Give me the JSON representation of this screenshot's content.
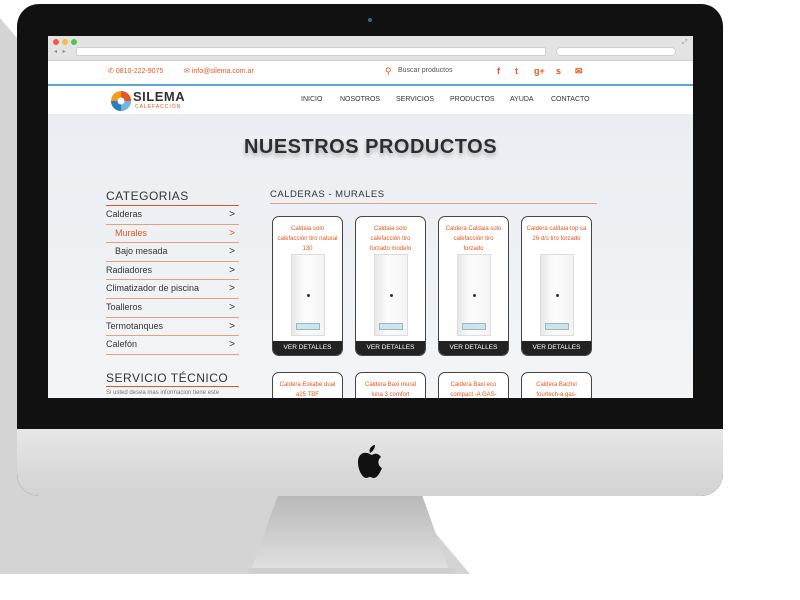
{
  "browser": {
    "address": "",
    "search_placeholder": ""
  },
  "topbar": {
    "phone": "0810-222-9075",
    "email": "info@silema.com.ar",
    "search_label": "Buscar productos",
    "social_icons": [
      "facebook-icon",
      "twitter-icon",
      "google-plus-icon",
      "skype-icon",
      "mail-icon"
    ]
  },
  "brand": {
    "name": "SILEMA",
    "tagline": "CALEFACCIÓN"
  },
  "nav": {
    "items": [
      "INICIO",
      "NOSOTROS",
      "SERVICIOS",
      "PRODUCTOS",
      "AYUDA",
      "CONTACTO"
    ]
  },
  "page": {
    "title": "NUESTROS PRODUCTOS"
  },
  "sidebar": {
    "heading": "CATEGORIAS",
    "items": [
      {
        "label": "Calderas"
      },
      {
        "label": "Murales"
      },
      {
        "label": "Bajo mesada"
      },
      {
        "label": "Radiadores"
      },
      {
        "label": "Climatizador de piscina"
      },
      {
        "label": "Toalleros"
      },
      {
        "label": "Termotanques"
      },
      {
        "label": "Calefón"
      }
    ],
    "service_heading": "SERVICIO TÉCNICO",
    "service_text": "Si usted desea mas informacion tiene este"
  },
  "products": {
    "section_title": "CALDERAS - MURALES",
    "details_label": "VER DETALLES",
    "row1": [
      {
        "name": "Caldaia solo calefacción tiro natural 130"
      },
      {
        "name": "Caldaia solo calefacción tiro forzado modelo"
      },
      {
        "name": "Caldera Caldaia solo calefacción tiro forzado"
      },
      {
        "name": "Caldera caldaia top sa 26 d/s tiro forzado"
      }
    ],
    "row2": [
      {
        "name": "Caldera Eskabe dual a25 TBF"
      },
      {
        "name": "Caldera Baxi mural luna 3 comfort"
      },
      {
        "name": "Caldera Baxi eco compact -A GAS-"
      },
      {
        "name": "Caldera Bachvi fourtech-a gas-"
      }
    ]
  },
  "colors": {
    "accent": "#e5571f",
    "nav_line": "#5aa8d8",
    "text": "#333333"
  }
}
